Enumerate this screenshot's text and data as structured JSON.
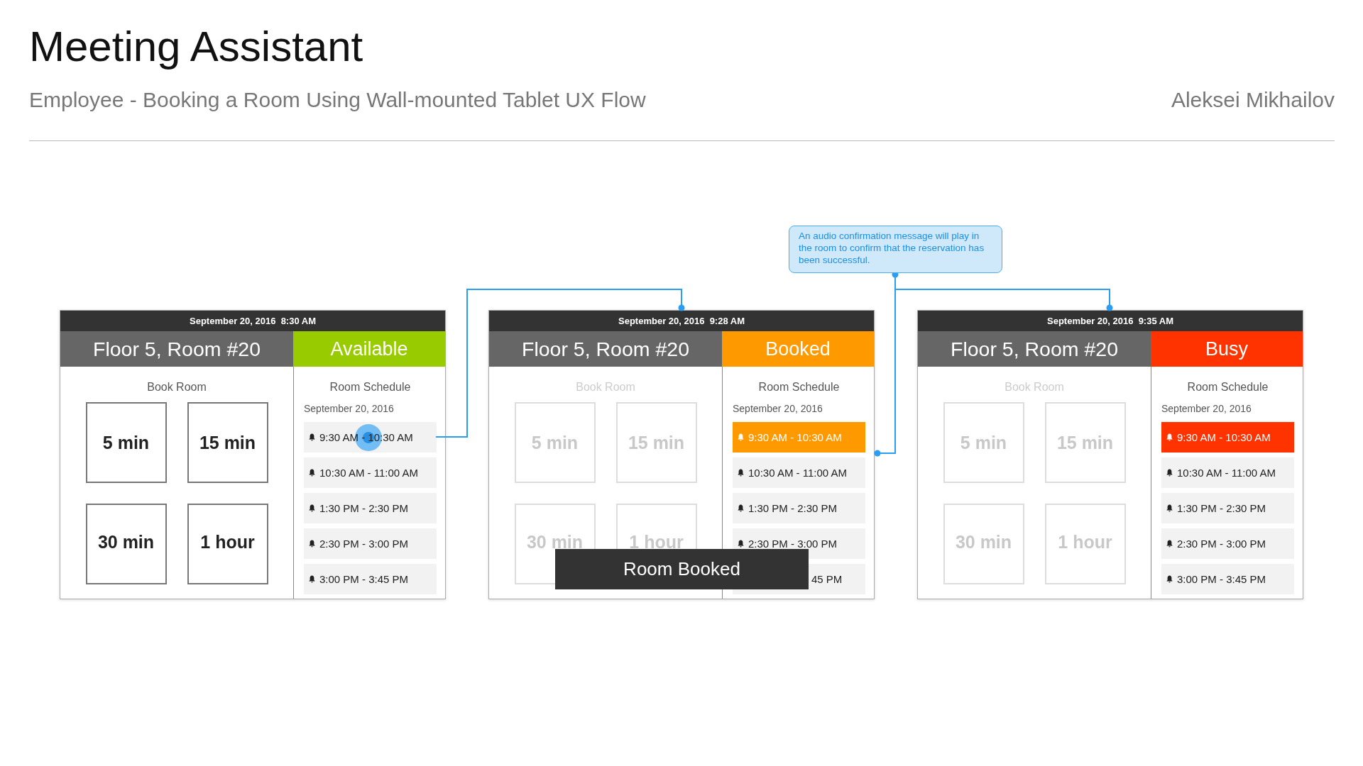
{
  "header": {
    "title": "Meeting Assistant",
    "subtitle": "Employee - Booking a Room Using Wall-mounted Tablet UX Flow",
    "author": "Aleksei Mikhailov"
  },
  "callout": {
    "text": "An audio confirmation message will play in the room to confirm that the reservation has been successful."
  },
  "screens": [
    {
      "datetime": "September 20, 2016  8:30 AM",
      "room": "Floor 5, Room #20",
      "status": {
        "label": "Available",
        "color": "#99cc00"
      },
      "book": {
        "title": "Book Room",
        "disabled": false,
        "options": [
          "5 min",
          "15 min",
          "30 min",
          "1 hour"
        ]
      },
      "schedule": {
        "title": "Room Schedule",
        "date": "September 20, 2016",
        "slots": [
          {
            "time": "9:30 AM - 10:30 AM",
            "highlighted": false,
            "touched": true
          },
          {
            "time": "10:30 AM - 11:00 AM",
            "highlighted": false,
            "touched": false
          },
          {
            "time": "1:30 PM - 2:30 PM",
            "highlighted": false,
            "touched": false
          },
          {
            "time": "2:30 PM - 3:00 PM",
            "highlighted": false,
            "touched": false
          },
          {
            "time": "3:00 PM - 3:45 PM",
            "highlighted": false,
            "touched": false
          }
        ]
      }
    },
    {
      "datetime": "September 20, 2016  9:28 AM",
      "room": "Floor 5, Room #20",
      "status": {
        "label": "Booked",
        "color": "#ff9900"
      },
      "book": {
        "title": "Book Room",
        "disabled": true,
        "options": [
          "5 min",
          "15 min",
          "30 min",
          "1 hour"
        ]
      },
      "schedule": {
        "title": "Room Schedule",
        "date": "September 20, 2016",
        "slots": [
          {
            "time": "9:30 AM - 10:30 AM",
            "highlighted": true,
            "touched": false
          },
          {
            "time": "10:30 AM - 11:00 AM",
            "highlighted": false,
            "touched": false
          },
          {
            "time": "1:30 PM - 2:30 PM",
            "highlighted": false,
            "touched": false
          },
          {
            "time": "2:30 PM - 3:00 PM",
            "highlighted": false,
            "touched": false
          },
          {
            "time": "45 PM",
            "highlighted": false,
            "touched": false,
            "kind": "covered"
          }
        ]
      },
      "toast": "Room Booked"
    },
    {
      "datetime": "September 20, 2016  9:35 AM",
      "room": "Floor 5, Room #20",
      "status": {
        "label": "Busy",
        "color": "#ff3300"
      },
      "book": {
        "title": "Book Room",
        "disabled": true,
        "options": [
          "5 min",
          "15 min",
          "30 min",
          "1 hour"
        ]
      },
      "schedule": {
        "title": "Room Schedule",
        "date": "September 20, 2016",
        "slots": [
          {
            "time": "9:30 AM - 10:30 AM",
            "highlighted": true,
            "touched": false
          },
          {
            "time": "10:30 AM - 11:00 AM",
            "highlighted": false,
            "touched": false
          },
          {
            "time": "1:30 PM - 2:30 PM",
            "highlighted": false,
            "touched": false
          },
          {
            "time": "2:30 PM - 3:00 PM",
            "highlighted": false,
            "touched": false
          },
          {
            "time": "3:00 PM - 3:45 PM",
            "highlighted": false,
            "touched": false
          }
        ]
      }
    }
  ]
}
